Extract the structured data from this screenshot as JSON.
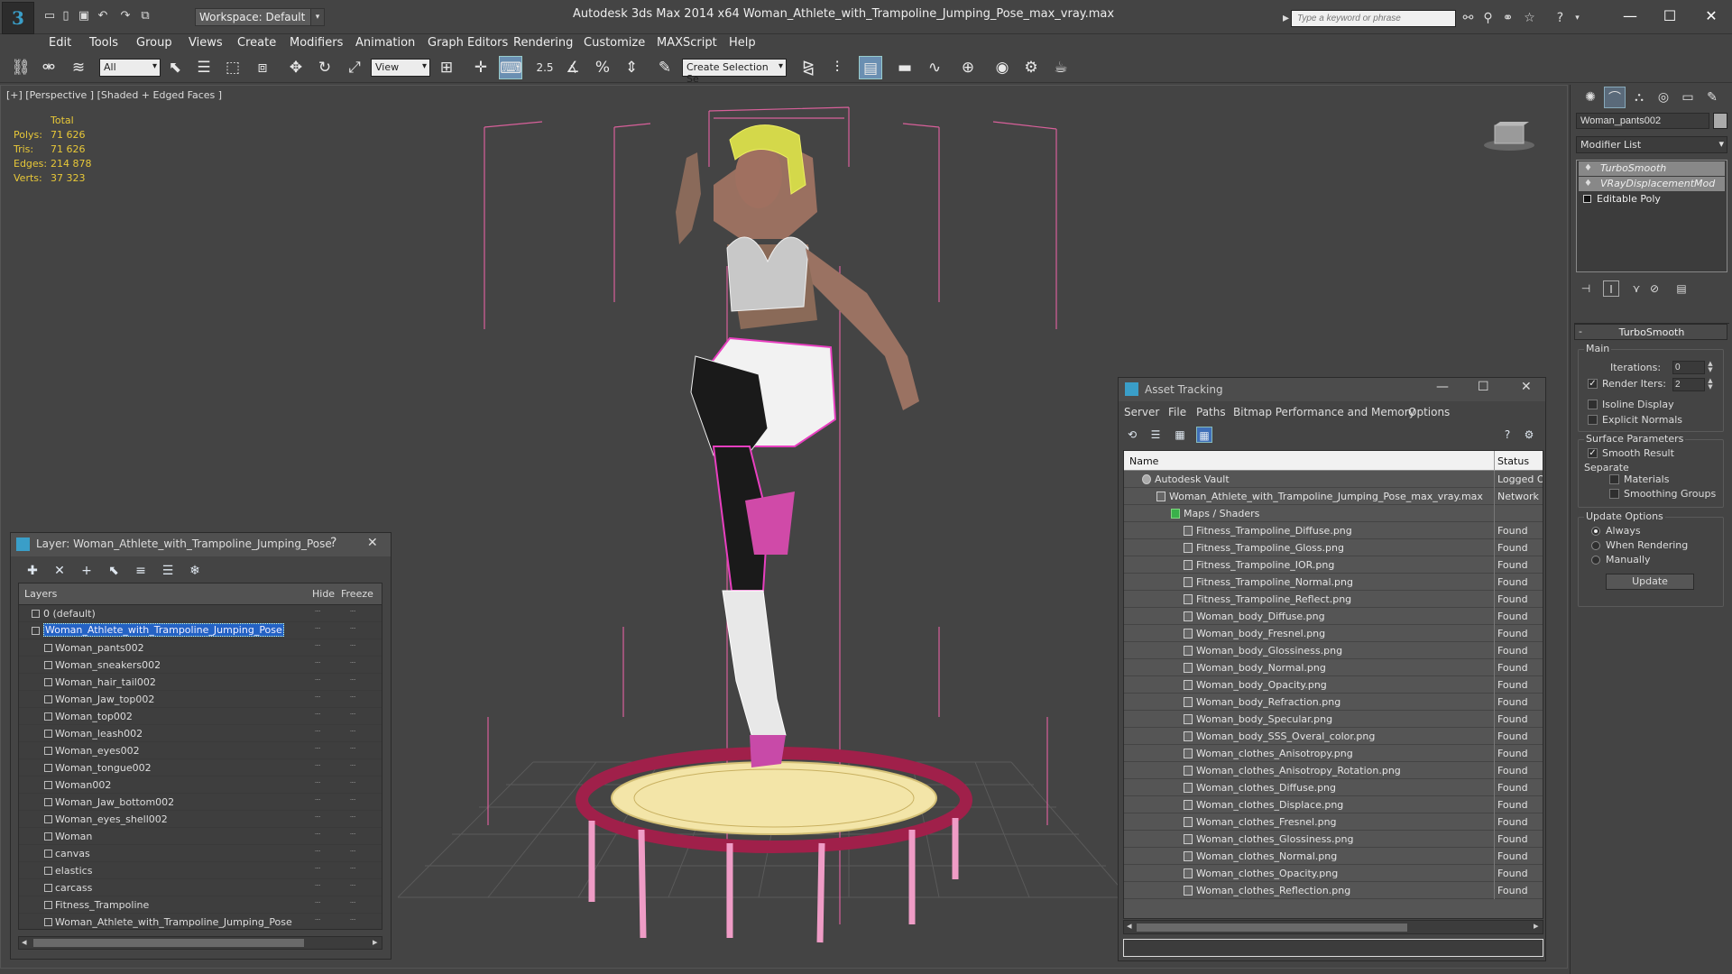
{
  "title_bar": {
    "app_title": "Autodesk 3ds Max  2014 x64       Woman_Athlete_with_Trampoline_Jumping_Pose_max_vray.max",
    "workspace_label": "Workspace: Default",
    "search_placeholder": "Type a keyword or phrase",
    "icons": [
      "new-icon",
      "open-icon",
      "save-icon",
      "undo-icon",
      "redo-icon",
      "hold-icon",
      "binoculars-icon",
      "search-icon",
      "network-icon",
      "star-icon",
      "help-icon"
    ]
  },
  "menu": {
    "items": [
      "Edit",
      "Tools",
      "Group",
      "Views",
      "Create",
      "Modifiers",
      "Animation",
      "Graph Editors",
      "Rendering",
      "Customize",
      "MAXScript",
      "Help"
    ]
  },
  "toolbar": {
    "selection_filter": "All",
    "ref_coord": "View",
    "named_selection": "Create Selection Se",
    "snap_value": "2.5"
  },
  "viewport": {
    "label": "[+] [Perspective ] [Shaded + Edged Faces ]",
    "stats_header": "Total",
    "stats": [
      {
        "label": "Polys:",
        "value": "71 626"
      },
      {
        "label": "Tris:",
        "value": "71 626"
      },
      {
        "label": "Edges:",
        "value": "214 878"
      },
      {
        "label": "Verts:",
        "value": "37 323"
      }
    ]
  },
  "layer_dialog": {
    "title": "Layer: Woman_Athlete_with_Trampoline_Jumping_Pose",
    "help": "?",
    "close": "✕",
    "columns": {
      "layers": "Layers",
      "hide": "Hide",
      "freeze": "Freeze"
    },
    "rows": [
      {
        "name": "0 (default)",
        "level": 0
      },
      {
        "name": "Woman_Athlete_with_Trampoline_Jumping_Pose",
        "level": 0,
        "selected": true
      },
      {
        "name": "Woman_pants002",
        "level": 1
      },
      {
        "name": "Woman_sneakers002",
        "level": 1
      },
      {
        "name": "Woman_hair_tail002",
        "level": 1
      },
      {
        "name": "Woman_Jaw_top002",
        "level": 1
      },
      {
        "name": "Woman_top002",
        "level": 1
      },
      {
        "name": "Woman_leash002",
        "level": 1
      },
      {
        "name": "Woman_eyes002",
        "level": 1
      },
      {
        "name": "Woman_tongue002",
        "level": 1
      },
      {
        "name": "Woman002",
        "level": 1
      },
      {
        "name": "Woman_Jaw_bottom002",
        "level": 1
      },
      {
        "name": "Woman_eyes_shell002",
        "level": 1
      },
      {
        "name": "Woman",
        "level": 1
      },
      {
        "name": "canvas",
        "level": 1
      },
      {
        "name": "elastics",
        "level": 1
      },
      {
        "name": "carcass",
        "level": 1
      },
      {
        "name": "Fitness_Trampoline",
        "level": 1
      },
      {
        "name": "Woman_Athlete_with_Trampoline_Jumping_Pose",
        "level": 1
      }
    ]
  },
  "asset_tracking": {
    "title": "Asset Tracking",
    "menu": [
      "Server",
      "File",
      "Paths",
      "Bitmap Performance and Memory",
      "Options"
    ],
    "columns": {
      "name": "Name",
      "status": "Status"
    },
    "rows": [
      {
        "name": "Autodesk Vault",
        "status": "Logged O",
        "level": 0
      },
      {
        "name": "Woman_Athlete_with_Trampoline_Jumping_Pose_max_vray.max",
        "status": "Network",
        "level": 1
      },
      {
        "name": "Maps / Shaders",
        "status": "",
        "level": 2
      },
      {
        "name": "Fitness_Trampoline_Diffuse.png",
        "status": "Found",
        "level": 3
      },
      {
        "name": "Fitness_Trampoline_Gloss.png",
        "status": "Found",
        "level": 3
      },
      {
        "name": "Fitness_Trampoline_IOR.png",
        "status": "Found",
        "level": 3
      },
      {
        "name": "Fitness_Trampoline_Normal.png",
        "status": "Found",
        "level": 3
      },
      {
        "name": "Fitness_Trampoline_Reflect.png",
        "status": "Found",
        "level": 3
      },
      {
        "name": "Woman_body_Diffuse.png",
        "status": "Found",
        "level": 3
      },
      {
        "name": "Woman_body_Fresnel.png",
        "status": "Found",
        "level": 3
      },
      {
        "name": "Woman_body_Glossiness.png",
        "status": "Found",
        "level": 3
      },
      {
        "name": "Woman_body_Normal.png",
        "status": "Found",
        "level": 3
      },
      {
        "name": "Woman_body_Opacity.png",
        "status": "Found",
        "level": 3
      },
      {
        "name": "Woman_body_Refraction.png",
        "status": "Found",
        "level": 3
      },
      {
        "name": "Woman_body_Specular.png",
        "status": "Found",
        "level": 3
      },
      {
        "name": "Woman_body_SSS_Overal_color.png",
        "status": "Found",
        "level": 3
      },
      {
        "name": "Woman_clothes_Anisotropy.png",
        "status": "Found",
        "level": 3
      },
      {
        "name": "Woman_clothes_Anisotropy_Rotation.png",
        "status": "Found",
        "level": 3
      },
      {
        "name": "Woman_clothes_Diffuse.png",
        "status": "Found",
        "level": 3
      },
      {
        "name": "Woman_clothes_Displace.png",
        "status": "Found",
        "level": 3
      },
      {
        "name": "Woman_clothes_Fresnel.png",
        "status": "Found",
        "level": 3
      },
      {
        "name": "Woman_clothes_Glossiness.png",
        "status": "Found",
        "level": 3
      },
      {
        "name": "Woman_clothes_Normal.png",
        "status": "Found",
        "level": 3
      },
      {
        "name": "Woman_clothes_Opacity.png",
        "status": "Found",
        "level": 3
      },
      {
        "name": "Woman_clothes_Reflection.png",
        "status": "Found",
        "level": 3
      }
    ]
  },
  "command_panel": {
    "object_name": "Woman_pants002",
    "modifier_list": "Modifier List",
    "stack": [
      {
        "name": "TurboSmooth",
        "type": "modifier"
      },
      {
        "name": "VRayDisplacementMod",
        "type": "modifier"
      },
      {
        "name": "Editable Poly",
        "type": "base"
      }
    ],
    "rollout": {
      "title": "TurboSmooth",
      "toggle": "-",
      "main_group": "Main",
      "iterations_label": "Iterations:",
      "iterations_value": "0",
      "render_iters_label": "Render Iters:",
      "render_iters_value": "2",
      "isoline_label": "Isoline Display",
      "explicit_normals_label": "Explicit Normals",
      "surface_group": "Surface Parameters",
      "smooth_result_label": "Smooth Result",
      "separate_label": "Separate",
      "materials_label": "Materials",
      "smoothing_groups_label": "Smoothing Groups",
      "update_group": "Update Options",
      "always_label": "Always",
      "when_rendering_label": "When Rendering",
      "manually_label": "Manually",
      "update_button": "Update"
    }
  },
  "colors": {
    "accent_blue": "#3a9ec8",
    "selection_blue": "#2462c4",
    "stats_yellow": "#e8c838",
    "wire_pink": "#e84ab8",
    "helper_pink": "#d8609a"
  }
}
